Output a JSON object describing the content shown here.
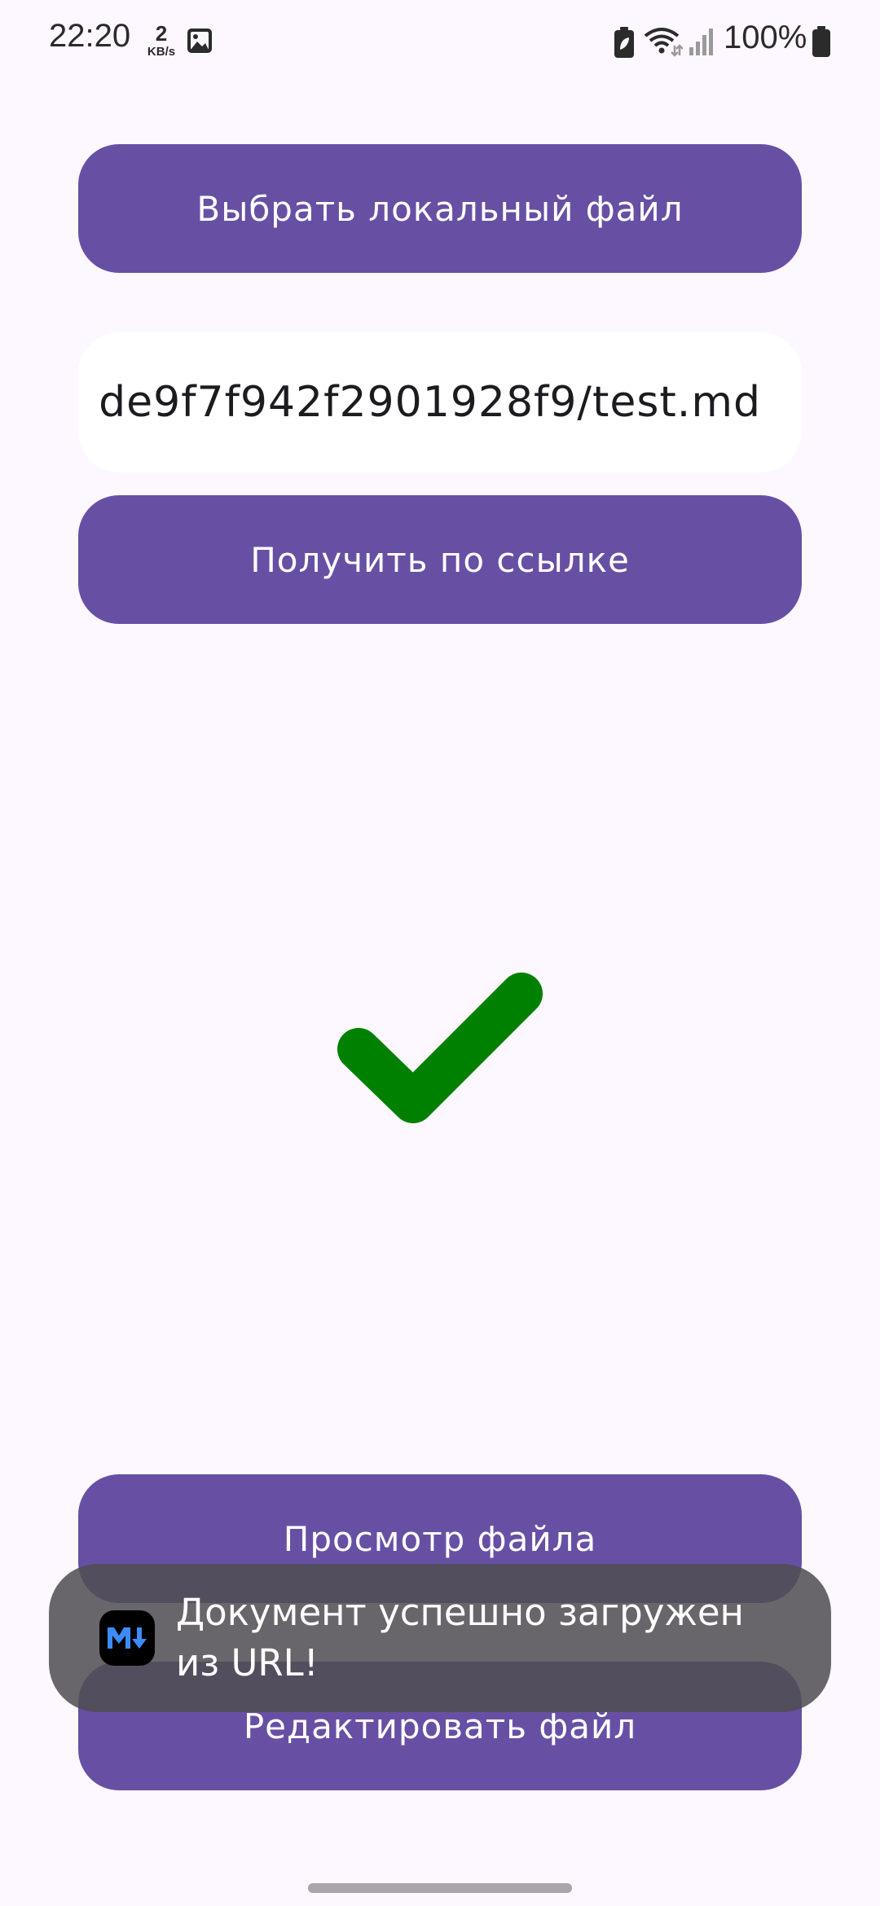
{
  "status_bar": {
    "time": "22:20",
    "net_speed_value": "2",
    "net_speed_unit": "KB/s",
    "battery_percent": "100%"
  },
  "buttons": {
    "choose_local": "Выбрать локальный файл",
    "get_by_url": "Получить по ссылке",
    "view_file": "Просмотр файла",
    "edit_file": "Редактировать файл"
  },
  "url_input": {
    "value": "de9f7f942f2901928f9/test.md"
  },
  "status_icon": "checkmark-icon",
  "toast": {
    "app_icon": "markdown-icon",
    "message": "Документ успешно загружен из URL!"
  },
  "colors": {
    "primary": "#6750a4",
    "background": "#fdf7ff",
    "success": "#008000"
  }
}
